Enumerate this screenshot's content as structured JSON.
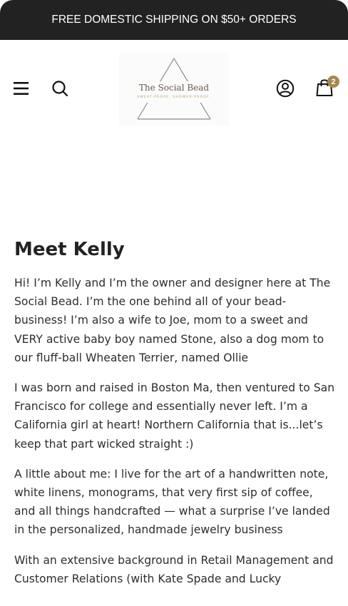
{
  "announcement": {
    "text": "FREE DOMESTIC SHIPPING ON $50+ ORDERS"
  },
  "header": {
    "logo": {
      "name": "The Social Bead",
      "tagline": "SWEAT-PROOF. SHOWER-PROOF."
    },
    "icons": {
      "menu": "hamburger-menu-icon",
      "search": "search-icon",
      "account": "account-icon",
      "cart": "shopping-bag-icon"
    },
    "cart_count": "2"
  },
  "main": {
    "title": "Meet Kelly",
    "paragraphs": [
      "Hi! I’m Kelly and I’m the owner and designer here at The Social Bead. I’m the one behind all of your bead-business! I’m also a wife to Joe, mom to a sweet and VERY active baby boy named Stone, also a dog mom to our fluff-ball Wheaten Terrier, named Ollie",
      "I was born and raised in Boston Ma, then ventured to San Francisco for college and essentially never left. I’m a California girl at heart! Northern California that is...let’s keep that part wicked straight :)",
      "A little about me: I live for the art of a handwritten note, white linens, monograms, that very first sip of coffee, and all things handcrafted — what a surprise I’ve landed in the personalized, handmade jewelry business",
      "With an extensive background in Retail Management and Customer Relations (with Kate Spade and Lucky"
    ]
  },
  "colors": {
    "announcement_bg": "#222222",
    "text": "#222222",
    "badge": "#a8874f",
    "logo_text": "#6b5a4c"
  }
}
